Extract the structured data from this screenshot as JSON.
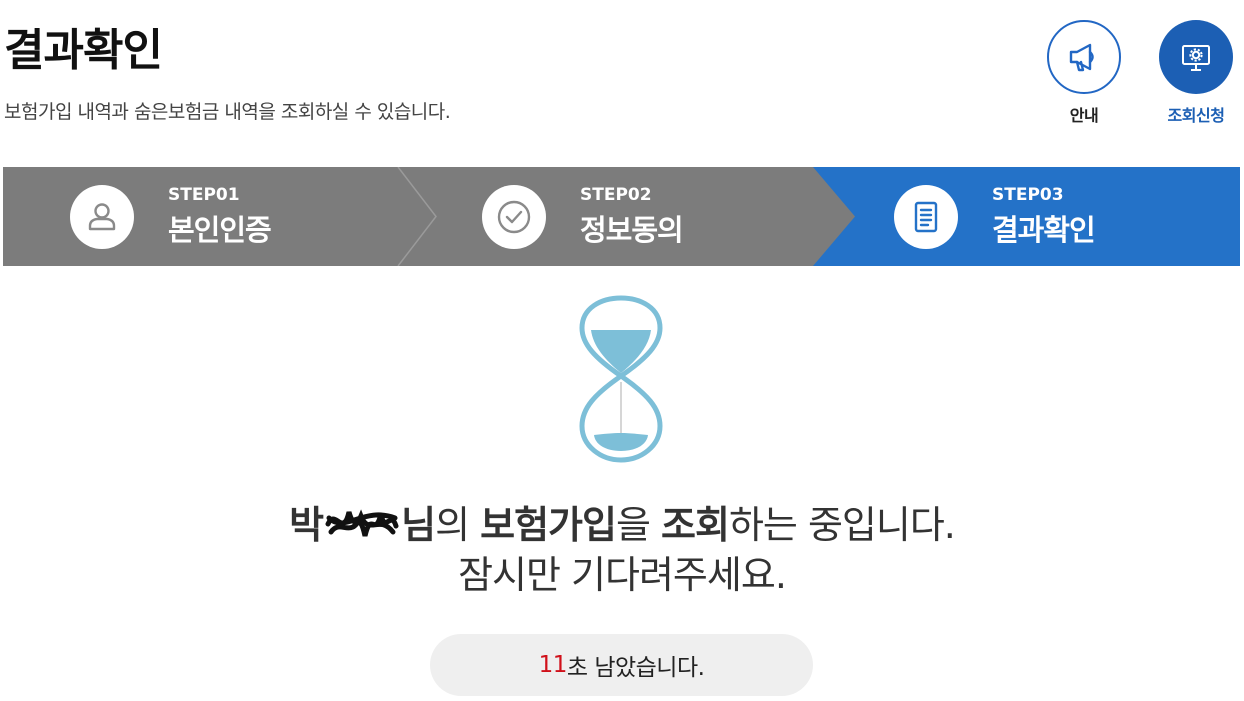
{
  "header": {
    "title": "결과확인",
    "description": "보험가입 내역과 숨은보험금 내역을 조회하실 수 있습니다."
  },
  "quick_menu": {
    "guide": {
      "label": "안내",
      "icon": "megaphone-icon"
    },
    "request": {
      "label": "조회신청",
      "icon": "monitor-gear-icon"
    }
  },
  "steps": [
    {
      "number": "STEP01",
      "name": "본인인증",
      "icon": "user-icon",
      "active": false
    },
    {
      "number": "STEP02",
      "name": "정보동의",
      "icon": "check-icon",
      "active": false
    },
    {
      "number": "STEP03",
      "name": "결과확인",
      "icon": "document-icon",
      "active": true
    }
  ],
  "status": {
    "name_first": "박",
    "name_suffix": "님",
    "particle_of": "의",
    "target": "보험가입",
    "particle_obj": "을",
    "action": "조회",
    "rest": "하는 중입니다.",
    "line2": "잠시만 기다려주세요."
  },
  "timer": {
    "seconds": "11",
    "text": "초 남았습니다."
  },
  "colors": {
    "active_step": "#2472c8",
    "inactive_step": "#7c7c7c",
    "hourglass": "#7dbfd8",
    "seconds": "#d0101a",
    "brand_blue": "#1c5fb4"
  }
}
